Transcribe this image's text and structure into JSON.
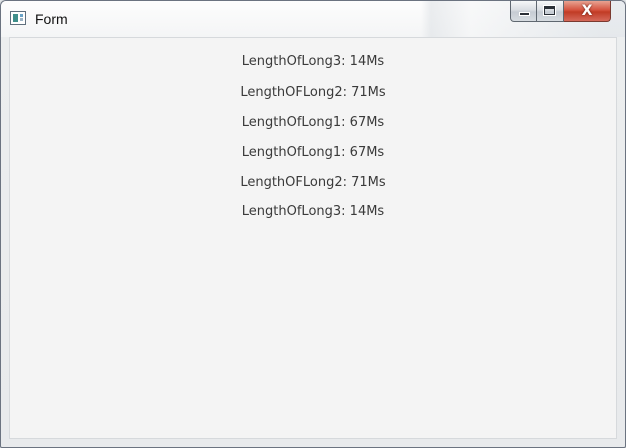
{
  "window": {
    "title": "Form",
    "icon": "form-app-icon",
    "close_glyph": "X"
  },
  "content": {
    "lines": [
      "LengthOfLong3: 14Ms",
      "LengthOFLong2: 71Ms",
      "LengthOfLong1: 67Ms",
      "LengthOfLong1: 67Ms",
      "LengthOFLong2: 71Ms",
      "LengthOfLong3: 14Ms"
    ]
  },
  "colors": {
    "client_background": "#f4f4f4",
    "text": "#3a3a3a",
    "close_button": "#c13b25"
  }
}
